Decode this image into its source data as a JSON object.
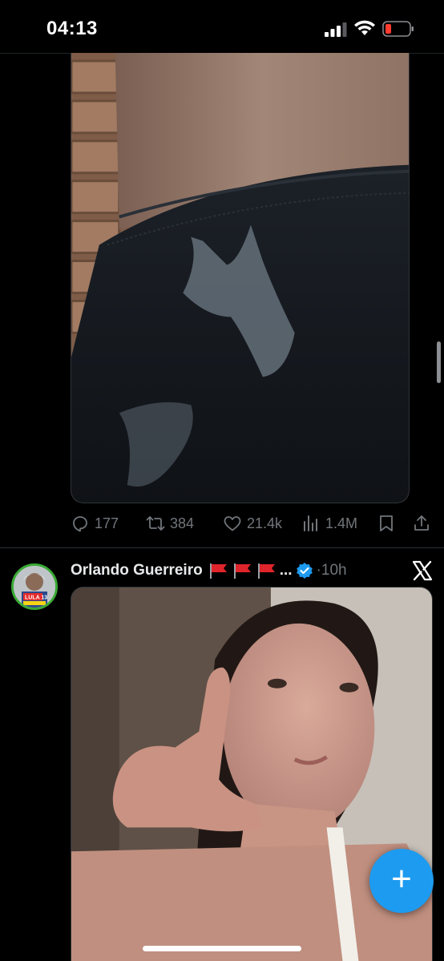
{
  "status_bar": {
    "time": "04:13",
    "signal_icon": "cellular-signal-icon",
    "wifi_icon": "wifi-icon",
    "battery_icon": "battery-low-icon",
    "battery_color": "#ff3b30"
  },
  "post_1": {
    "media_description_icon": "photo",
    "actions": {
      "replies": "177",
      "reposts": "384",
      "likes": "21.4k",
      "views": "1.4M"
    },
    "action_icons": [
      "reply-icon",
      "repost-icon",
      "like-icon",
      "views-icon",
      "bookmark-icon",
      "share-icon"
    ]
  },
  "post_2": {
    "author_name": "Orlando Guerreiro",
    "truncation": "...",
    "separator": "·",
    "timestamp": "10h",
    "avatar_text": "LULA 13",
    "badge_color": "#1d9bf0"
  },
  "fab": {
    "label": "+",
    "color": "#1d9bf0"
  },
  "colors": {
    "background": "#000000",
    "muted_text": "#71767b",
    "primary_text": "#e7e9ea",
    "accent": "#1d9bf0"
  }
}
